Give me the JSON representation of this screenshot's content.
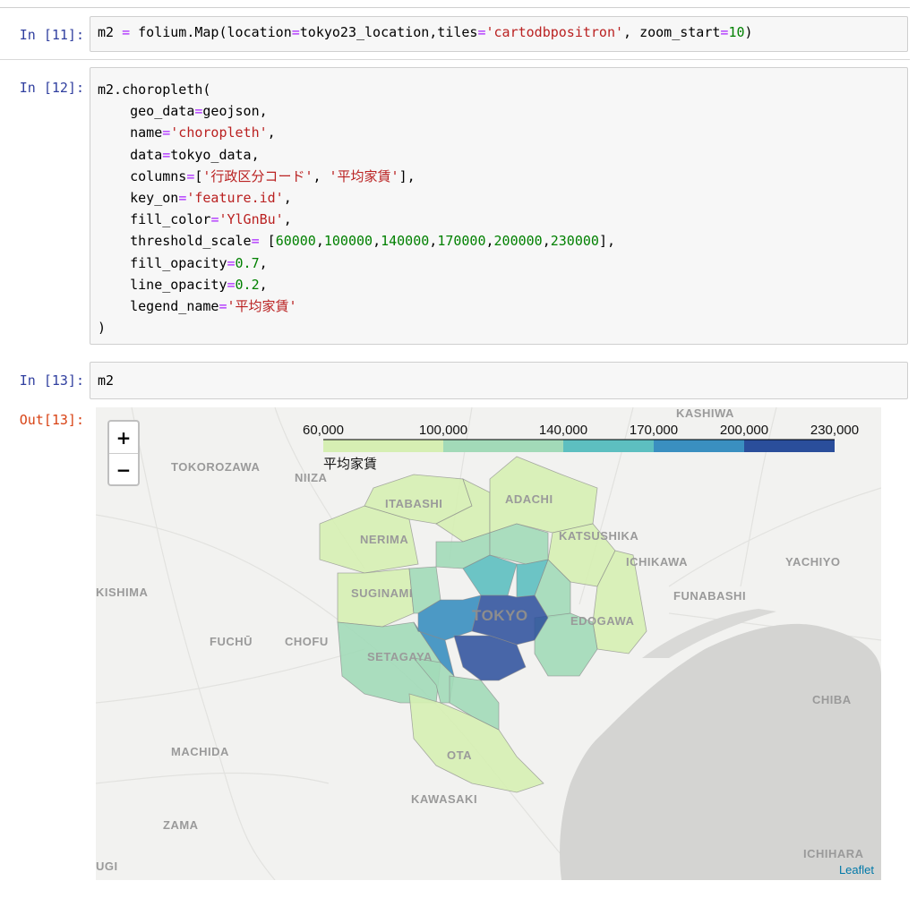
{
  "cells": {
    "c11": {
      "prompt": "In [11]:"
    },
    "c12": {
      "prompt": "In [12]:"
    },
    "c13": {
      "prompt": "In [13]:",
      "code": "m2",
      "out_prompt": "Out[13]:"
    }
  },
  "map": {
    "zoom_in": "+",
    "zoom_out": "−",
    "attribution": "Leaflet",
    "legend": {
      "ticks": [
        "60,000",
        "100,000",
        "140,000",
        "170,000",
        "200,000",
        "230,000"
      ],
      "title": "平均家賃",
      "colors": [
        "#d6efb3",
        "#a2dab8",
        "#5dbfc0",
        "#3a8fc0",
        "#2a4e9b"
      ]
    },
    "place_labels": [
      "KASHIWA",
      "TOKOROZAWA",
      "NIIZA",
      "ITABASHI",
      "ADACHI",
      "NERIMA",
      "KATSUSHIKA",
      "ICHIKAWA",
      "YACHIYO",
      "KISHIMA",
      "SUGINAMI",
      "FUNABASHI",
      "TOKYO",
      "EDOGAWA",
      "FUCHŪ",
      "CHOFU",
      "SETAGAYA",
      "CHIBA",
      "MACHIDA",
      "OTA",
      "KAWASAKI",
      "ZAMA",
      "ICHIHARA",
      "UGI"
    ]
  }
}
